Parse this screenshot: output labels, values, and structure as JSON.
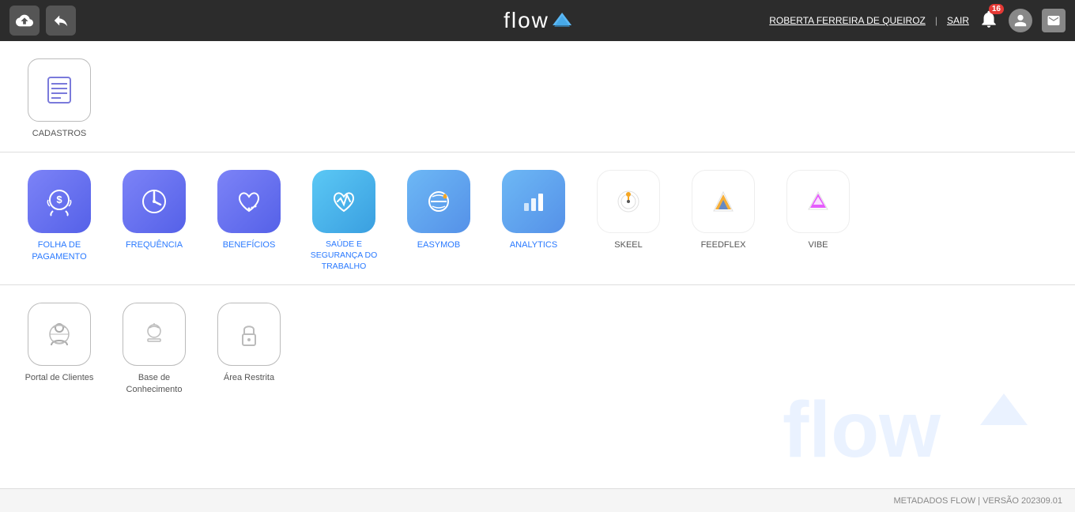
{
  "header": {
    "logo": "flow",
    "logo_icon": "▲",
    "user_name": "ROBERTA FERREIRA DE QUEIROZ",
    "separator": "|",
    "logout_label": "SAIR",
    "notification_count": "16"
  },
  "section1": {
    "apps": [
      {
        "id": "cadastros",
        "label": "CADASTROS",
        "icon_type": "cadastros",
        "color_class": "dark-gray"
      }
    ]
  },
  "section2": {
    "apps": [
      {
        "id": "folha",
        "label": "FOLHA DE PAGAMENTO",
        "icon_type": "folha",
        "color_class": "blue"
      },
      {
        "id": "frequencia",
        "label": "FREQUÊNCIA",
        "icon_type": "frequencia",
        "color_class": "blue"
      },
      {
        "id": "beneficios",
        "label": "BENEFÍCIOS",
        "icon_type": "beneficios",
        "color_class": "blue"
      },
      {
        "id": "saude",
        "label": "SAÚDE E SEGURANÇA DO TRABALHO",
        "icon_type": "saude",
        "color_class": "blue"
      },
      {
        "id": "easymob",
        "label": "EASYMOB",
        "icon_type": "easymob",
        "color_class": "blue"
      },
      {
        "id": "analytics",
        "label": "ANALYTICS",
        "icon_type": "analytics",
        "color_class": "blue"
      },
      {
        "id": "skeel",
        "label": "SKEEL",
        "icon_type": "skeel",
        "color_class": "dark-gray"
      },
      {
        "id": "feedflex",
        "label": "FEEDFLEX",
        "icon_type": "feedflex",
        "color_class": "dark-gray"
      },
      {
        "id": "vibe",
        "label": "VIBE",
        "icon_type": "vibe",
        "color_class": "dark-gray"
      }
    ]
  },
  "section3": {
    "apps": [
      {
        "id": "portal",
        "label": "Portal de Clientes",
        "icon_type": "portal",
        "color_class": "dark-gray"
      },
      {
        "id": "base",
        "label": "Base de Conhecimento",
        "icon_type": "base",
        "color_class": "dark-gray"
      },
      {
        "id": "area",
        "label": "Área Restrita",
        "icon_type": "area",
        "color_class": "dark-gray"
      }
    ]
  },
  "footer": {
    "text": "METADADOS FLOW | VERSÃO 202309.01"
  }
}
